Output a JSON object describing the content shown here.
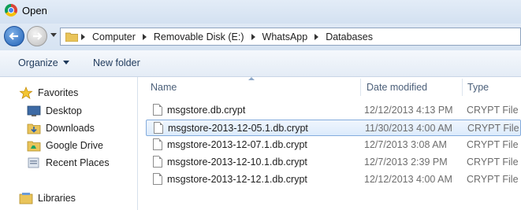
{
  "window": {
    "title": "Open"
  },
  "address": {
    "crumbs": [
      "Computer",
      "Removable Disk (E:)",
      "WhatsApp",
      "Databases"
    ]
  },
  "toolbar": {
    "organize_label": "Organize",
    "new_folder_label": "New folder"
  },
  "navpane": {
    "favorites_label": "Favorites",
    "items": [
      "Desktop",
      "Downloads",
      "Google Drive",
      "Recent Places"
    ],
    "libraries_label": "Libraries"
  },
  "columns": {
    "name": "Name",
    "date": "Date modified",
    "type": "Type"
  },
  "files": [
    {
      "name": "msgstore.db.crypt",
      "date": "12/12/2013 4:13 PM",
      "type": "CRYPT File"
    },
    {
      "name": "msgstore-2013-12-05.1.db.crypt",
      "date": "11/30/2013 4:00 AM",
      "type": "CRYPT File"
    },
    {
      "name": "msgstore-2013-12-07.1.db.crypt",
      "date": "12/7/2013 3:08 AM",
      "type": "CRYPT File"
    },
    {
      "name": "msgstore-2013-12-10.1.db.crypt",
      "date": "12/7/2013 2:39 PM",
      "type": "CRYPT File"
    },
    {
      "name": "msgstore-2013-12-12.1.db.crypt",
      "date": "12/12/2013 4:00 AM",
      "type": "CRYPT File"
    }
  ],
  "selected_index": 1
}
